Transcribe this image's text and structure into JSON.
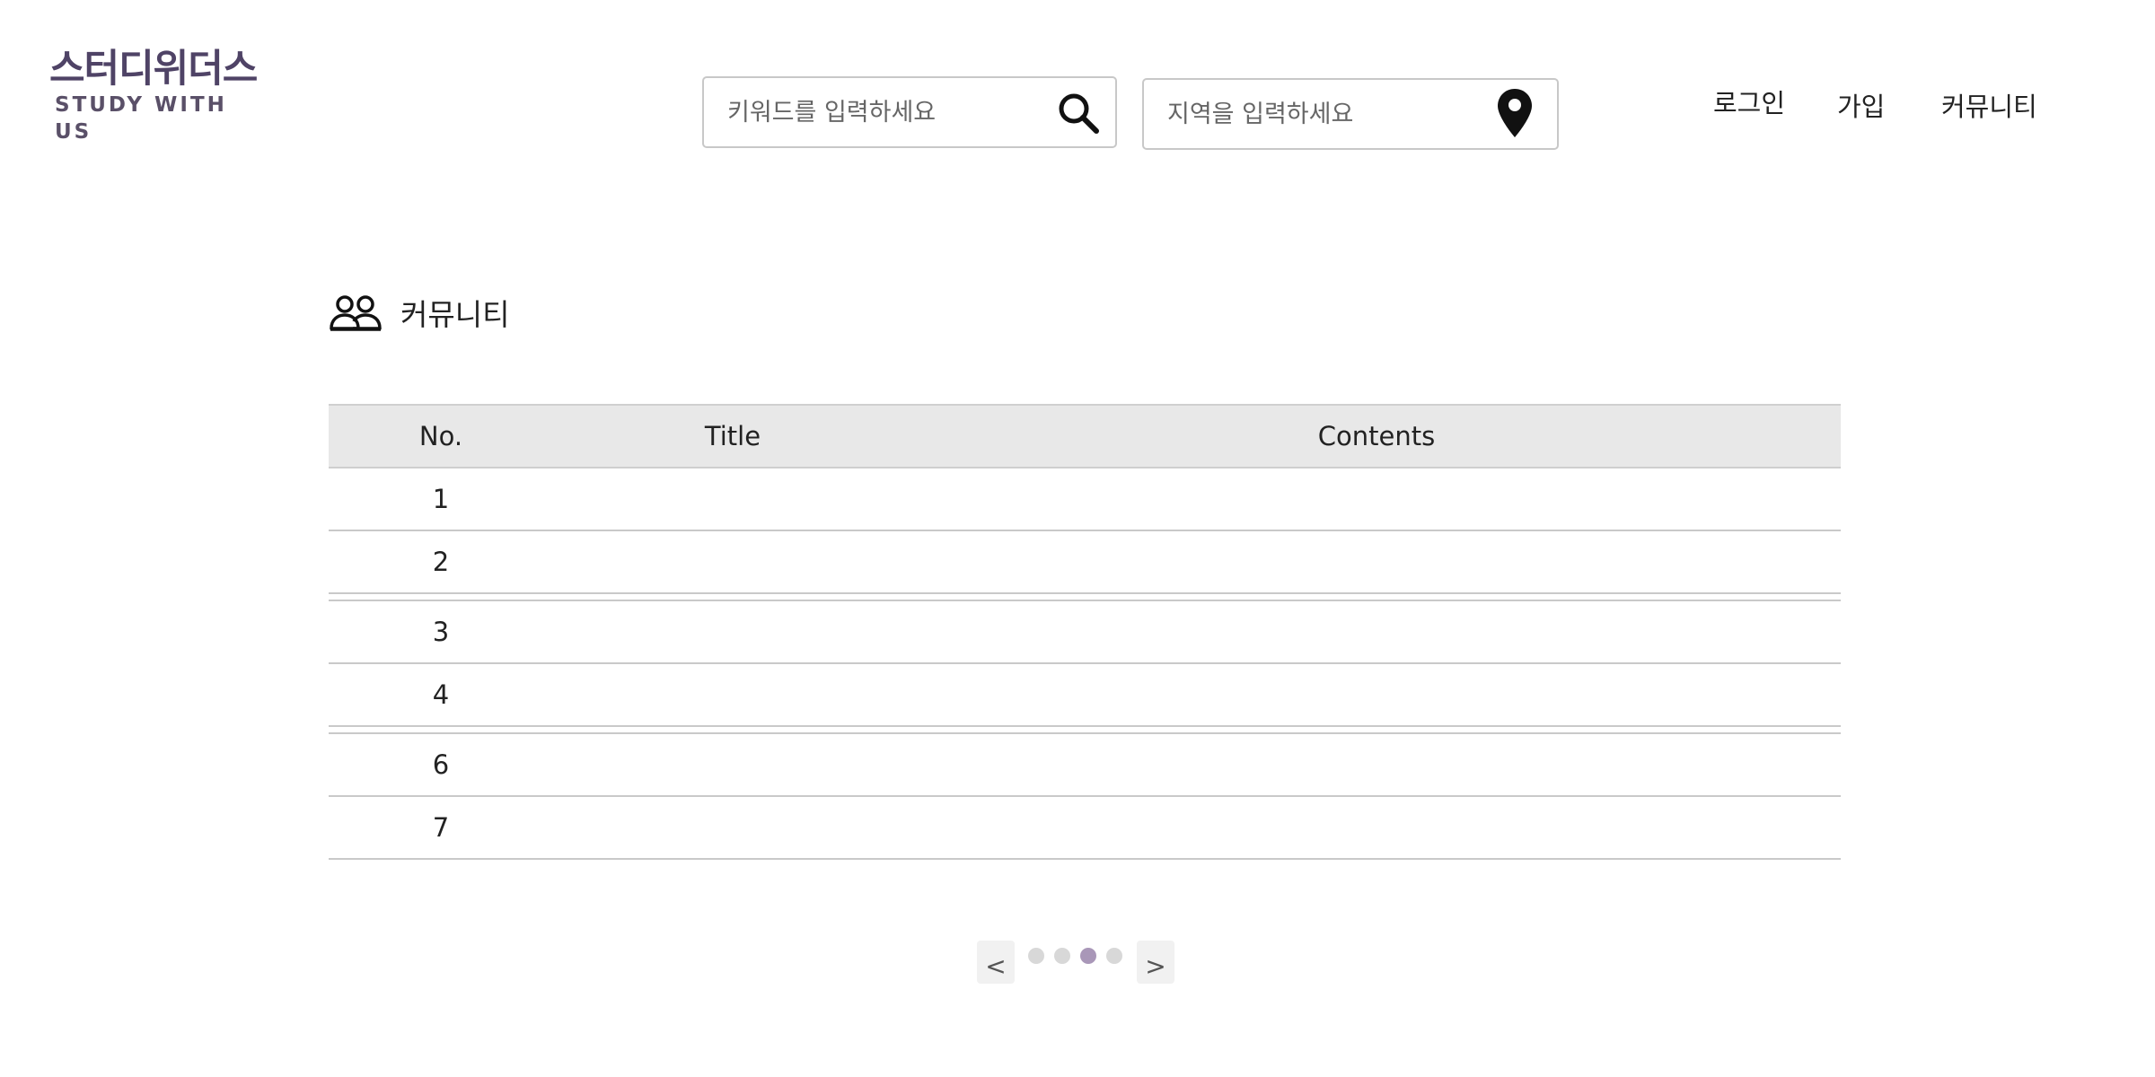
{
  "header": {
    "logo_kr": "스터디위더스",
    "logo_en": "STUDY WITH US",
    "keyword_search": {
      "placeholder": "키워드를 입력하세요",
      "value": ""
    },
    "region_search": {
      "placeholder": "지역을 입력하세요",
      "value": ""
    },
    "nav": {
      "login": "로그인",
      "signup": "가입",
      "community": "커뮤니티"
    }
  },
  "section": {
    "title": "커뮤니티",
    "icon": "people-icon"
  },
  "board": {
    "columns": [
      "No.",
      "Title",
      "Contents"
    ],
    "rows": [
      {
        "no": "1",
        "title": "",
        "contents": ""
      },
      {
        "no": "2",
        "title": "",
        "contents": ""
      },
      {
        "no": "3",
        "title": "",
        "contents": ""
      },
      {
        "no": "4",
        "title": "",
        "contents": ""
      },
      {
        "no": "6",
        "title": "",
        "contents": ""
      },
      {
        "no": "7",
        "title": "",
        "contents": ""
      }
    ]
  },
  "pagination": {
    "prev": "<",
    "next": ">",
    "pages": 4,
    "active_page": 3
  },
  "colors": {
    "logo": "#4f4366",
    "active_dot": "#a997b8",
    "inactive_dot": "#d8d8d8",
    "header_row_bg": "#e8e8e8"
  }
}
